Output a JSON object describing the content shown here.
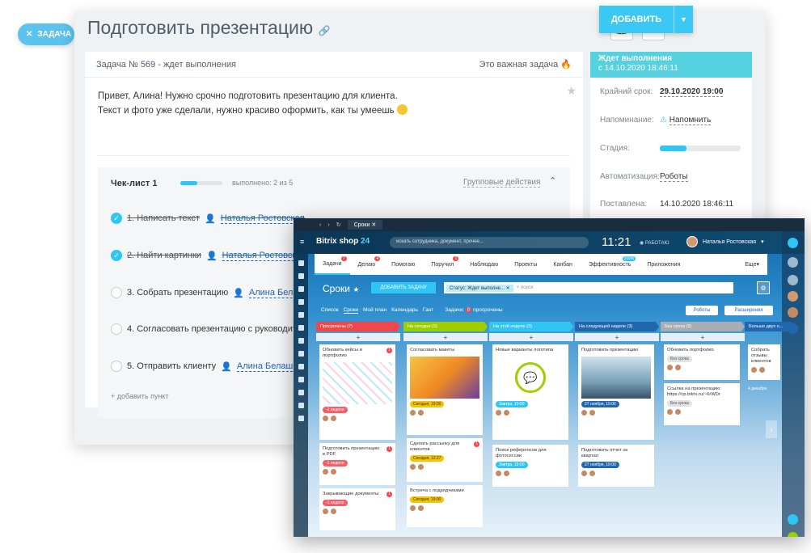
{
  "chip": {
    "label": "ЗАДАЧА"
  },
  "header": {
    "title": "Подготовить презентацию",
    "add_label": "ДОБАВИТЬ"
  },
  "task": {
    "number_status": "Задача № 569 - ждет выполнения",
    "important": "Это важная задача",
    "description_line1": "Привет, Алина! Нужно срочно подготовить презентацию для клиента.",
    "description_line2": "Текст и фото уже сделали, нужно красиво оформить, как ты умеешь"
  },
  "checklist": {
    "title": "Чек-лист 1",
    "progress_text": "выполнено: 2 из 5",
    "progress_fraction": 0.4,
    "group_actions": "Групповые действия",
    "items": [
      {
        "label": "1. Написать текст",
        "assignee": "Наталья Ростовская",
        "done": true
      },
      {
        "label": "2. Найти картинки",
        "assignee": "Наталья Ростовская",
        "done": true
      },
      {
        "label": "3. Собрать презентацию",
        "assignee": "Алина Белаш",
        "done": false
      },
      {
        "label": "4. Согласовать презентацию с руководителем",
        "assignee": "",
        "done": false
      },
      {
        "label": "5. Отправить клиенту",
        "assignee": "Алина Белаш",
        "done": false
      }
    ],
    "add_item": "+ добавить пункт"
  },
  "side": {
    "status": "Ждет выполнения",
    "status_since": "с 14.10.2020 18:46:11",
    "deadline_label": "Крайний срок:",
    "deadline_value": "29.10.2020 19:00",
    "reminder_label": "Напоминание:",
    "reminder_value": "Напомнить",
    "stage_label": "Стадия:",
    "stage_fraction": 0.33,
    "automation_label": "Автоматизация:",
    "automation_value": "Роботы",
    "created_label": "Поставлена:",
    "created_value": "14.10.2020 18:46:11"
  },
  "b24": {
    "tab_title": "Сроки",
    "logo": "Bitrix shop",
    "logo_num": "24",
    "search_placeholder": "искать сотрудника, документ, прочее...",
    "clock": "11:21",
    "work_status": "РАБОТАЮ",
    "user": "Наталья Ростовская",
    "tabs": [
      {
        "label": "Задачи",
        "badge": "7"
      },
      {
        "label": "Делаю",
        "badge": "4"
      },
      {
        "label": "Помогаю",
        "badge": ""
      },
      {
        "label": "Поручил",
        "badge": "1"
      },
      {
        "label": "Наблюдаю",
        "badge": ""
      },
      {
        "label": "Проекты",
        "badge": ""
      },
      {
        "label": "Канбан",
        "badge": ""
      },
      {
        "label": "Эффективность",
        "badge": "100%"
      },
      {
        "label": "Приложения",
        "badge": ""
      },
      {
        "label": "Еще",
        "badge": ""
      }
    ],
    "page_title": "Сроки",
    "add_task": "ДОБАВИТЬ ЗАДАЧУ",
    "filter_chip": "Статус: Ждет выполне...",
    "filter_placeholder": "+ поиск",
    "subnav": [
      "Список",
      "Сроки",
      "Мой план",
      "Календарь",
      "Гант",
      "Задачи:",
      "0",
      "просрочены"
    ],
    "robots": "Роботы",
    "extension": "Расширения",
    "columns": [
      {
        "title": "Просрочены (7)",
        "color": "#f0474d"
      },
      {
        "title": "На сегодня (3)",
        "color": "#9dcf00"
      },
      {
        "title": "На этой неделе (3)",
        "color": "#2fc6f6"
      },
      {
        "title": "На следующей неделе (3)",
        "color": "#2067b0"
      },
      {
        "title": "Без срока (3)",
        "color": "#a8adb4"
      },
      {
        "title": "Больше двух н...",
        "color": "#2067b0"
      }
    ],
    "cards": {
      "c1a": {
        "title": "Обновить кейсы и портфолио",
        "badge": "1",
        "pill": "-1 недели"
      },
      "c1b": {
        "title": "Подготовить презентацию в PDF",
        "badge": "1",
        "pill": "-1 недели"
      },
      "c1c": {
        "title": "Закрывающие документы",
        "badge": "1",
        "pill": "-1 недели"
      },
      "c2a": {
        "title": "Согласовать макеты",
        "pill": "Сегодня, 19:00"
      },
      "c2b": {
        "title": "Сделать рассылку для клиентов",
        "badge": "1",
        "pill": "Сегодня, 12:27"
      },
      "c2c": {
        "title": "Встреча с подрядчиками",
        "pill": "Сегодня, 19:00"
      },
      "c3a": {
        "title": "Новые варианты логотипа",
        "pill": "Завтра, 19:00"
      },
      "c3b": {
        "title": "Поиск референсов для фотосессии",
        "pill": "Завтра, 19:00"
      },
      "c4a": {
        "title": "Подготовить презентацию",
        "pill": "27 ноября, 19:00"
      },
      "c4b": {
        "title": "Подготовить отчет за квартал",
        "pill": "27 ноября, 19:00"
      },
      "c5a": {
        "title": "Обновить портфолио",
        "pill": "Без срока"
      },
      "c5b": {
        "title": "Ссылка на презентацию: https://cp.bitrix.ru/~6rWDr",
        "pill": "Без срока"
      },
      "c6a": {
        "title": "Собрать отзывы клиентов",
        "pill": "4 декабря"
      }
    }
  }
}
